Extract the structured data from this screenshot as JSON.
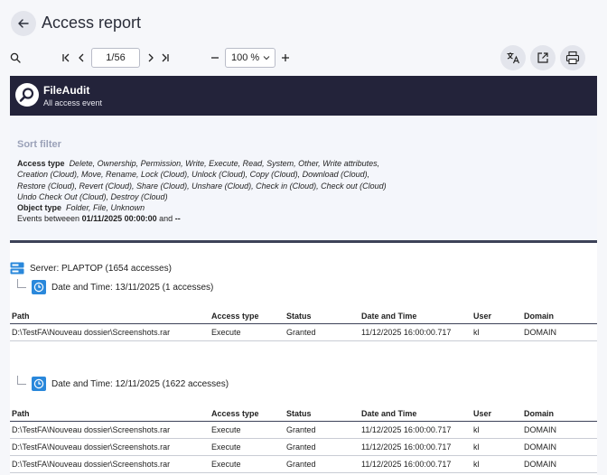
{
  "header": {
    "title": "Access report"
  },
  "toolbar": {
    "page_value": "1/56",
    "zoom_value": "100 %"
  },
  "report": {
    "brand": "FileAudit",
    "subtitle": "All access event",
    "filter": {
      "heading": "Sort filter",
      "access_type_label": "Access type",
      "access_type_values": "Delete, Ownership, Permission, Write, Execute, Read, System, Other, Write attributes, Creation (Cloud), Move, Rename, Lock (Cloud), Unlock (Cloud), Copy (Cloud), Download (Cloud), Restore (Cloud), Revert (Cloud), Share (Cloud), Unshare (Cloud), Check in (Cloud), Check out (Cloud) Undo Check Out (Cloud), Destroy (Cloud)",
      "access_line1": "Delete, Ownership, Permission, Write, Execute, Read, System, Other, Write attributes,",
      "access_line2": "Creation (Cloud), Move, Rename, Lock (Cloud), Unlock (Cloud), Copy (Cloud), Download (Cloud),",
      "access_line3": "Restore (Cloud), Revert (Cloud), Share (Cloud), Unshare (Cloud), Check in (Cloud), Check out (Cloud)",
      "access_line4": "Undo Check Out (Cloud), Destroy (Cloud)",
      "object_type_label": "Object type",
      "object_type_values": "Folder, File, Unknown",
      "events_label": "Events betweeen",
      "events_from": "01/11/2025 00:00:00",
      "events_and": "and",
      "events_to": "--"
    },
    "server_label": "Server: PLAPTOP (1654 accesses)",
    "columns": [
      "Path",
      "Access type",
      "Status",
      "Date and Time",
      "User",
      "Domain"
    ],
    "groups": [
      {
        "label": "Date and Time: 13/11/2025 (1 accesses)",
        "rows": [
          [
            "D:\\TestFA\\Nouveau dossier\\Screenshots.rar",
            "Execute",
            "Granted",
            "11/12/2025 16:00:00.717",
            "kl",
            "DOMAIN"
          ]
        ]
      },
      {
        "label": "Date and Time: 12/11/2025 (1622 accesses)",
        "rows": [
          [
            "D:\\TestFA\\Nouveau dossier\\Screenshots.rar",
            "Execute",
            "Granted",
            "11/12/2025 16:00:00.717",
            "kl",
            "DOMAIN"
          ],
          [
            "D:\\TestFA\\Nouveau dossier\\Screenshots.rar",
            "Execute",
            "Granted",
            "11/12/2025 16:00:00.717",
            "kl",
            "DOMAIN"
          ],
          [
            "D:\\TestFA\\Nouveau dossier\\Screenshots.rar",
            "Execute",
            "Granted",
            "11/12/2025 16:00:00.717",
            "kl",
            "DOMAIN"
          ]
        ]
      }
    ]
  },
  "icons": {
    "back": "arrow-left-icon",
    "search": "search-icon",
    "first": "first-page-icon",
    "prev": "chevron-left-icon",
    "next": "chevron-right-icon",
    "last": "last-page-icon",
    "zoom_out": "minus-icon",
    "zoom_in": "plus-icon",
    "translate": "translate-icon",
    "open": "open-external-icon",
    "print": "print-icon",
    "server": "server-icon",
    "clock": "clock-icon"
  },
  "colors": {
    "banner": "#23233a",
    "accent": "#2a88db",
    "background": "#f6f7fa"
  }
}
